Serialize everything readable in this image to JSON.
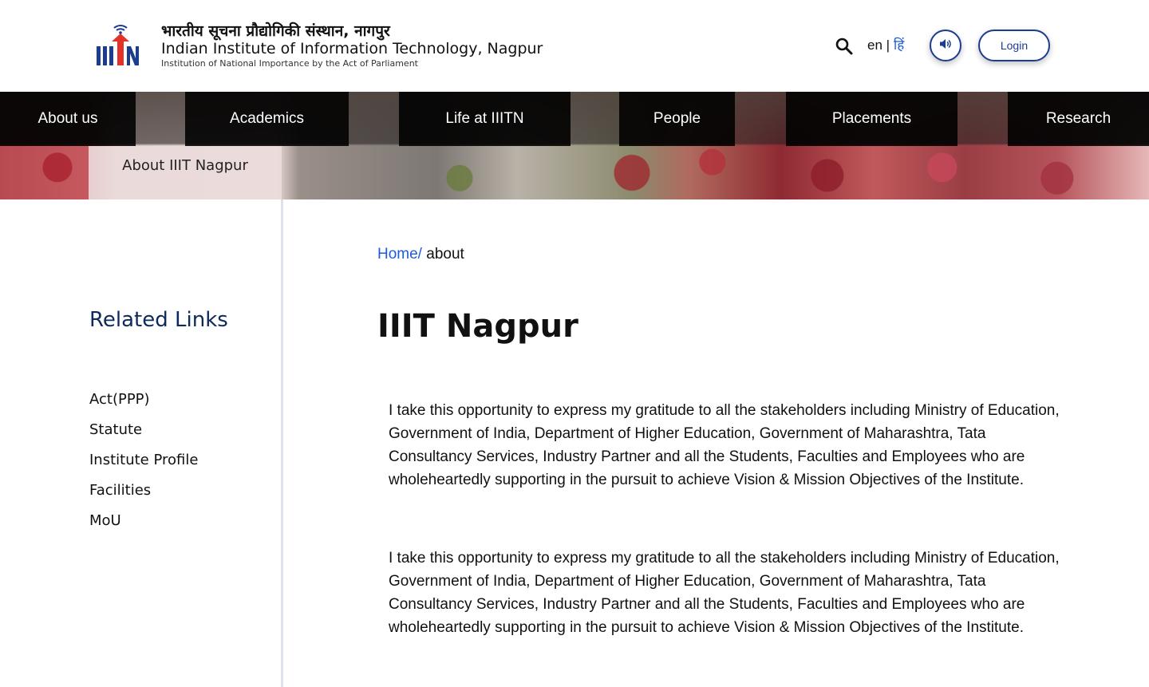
{
  "header": {
    "title_hindi": "भारतीय सूचना प्रौद्योगिकी संस्थान, नागपुर",
    "title_english": "Indian Institute of Information Technology, Nagpur",
    "subtitle": "Institution of National Importance by the Act of Parliament",
    "logo_icon": "iiitn-logo-icon",
    "search_icon": "search-icon",
    "lang_en": "en",
    "lang_sep": "|",
    "lang_hi": "हिं",
    "audio_icon": "speaker-icon",
    "login_label": "Login",
    "colors": {
      "brand_blue": "#1c3d8f",
      "link_blue": "#1e5bd8",
      "logo_red": "#e2322a"
    }
  },
  "nav": {
    "items": [
      {
        "label": "About us"
      },
      {
        "label": "Academics"
      },
      {
        "label": "Life at IIITN"
      },
      {
        "label": "People"
      },
      {
        "label": "Placements"
      },
      {
        "label": "Research"
      }
    ],
    "active_tab": "About IIIT Nagpur"
  },
  "sidebar": {
    "title": "Related Links",
    "links": [
      "Act(PPP)",
      "Statute",
      "Institute Profile",
      "Facilities",
      "MoU"
    ]
  },
  "main": {
    "breadcrumb_home": "Home/",
    "breadcrumb_current": "about",
    "page_title": "IIIT Nagpur",
    "paragraphs": [
      "I take this opportunity to express my gratitude to all the stakeholders including Ministry of Education, Government of India, Department of Higher Education, Government of Maharashtra, Tata Consultancy Services, Industry Partner and all the Students, Faculties and Employees who are wholeheartedly supporting in the pursuit to achieve Vision & Mission Objectives of the Institute.",
      "I take this opportunity to express my gratitude to all the stakeholders including Ministry of Education, Government of India, Department of Higher Education, Government of Maharashtra, Tata Consultancy Services, Industry Partner and all the Students, Faculties and Employees who are wholeheartedly supporting in the pursuit to achieve Vision & Mission Objectives of the Institute."
    ]
  }
}
